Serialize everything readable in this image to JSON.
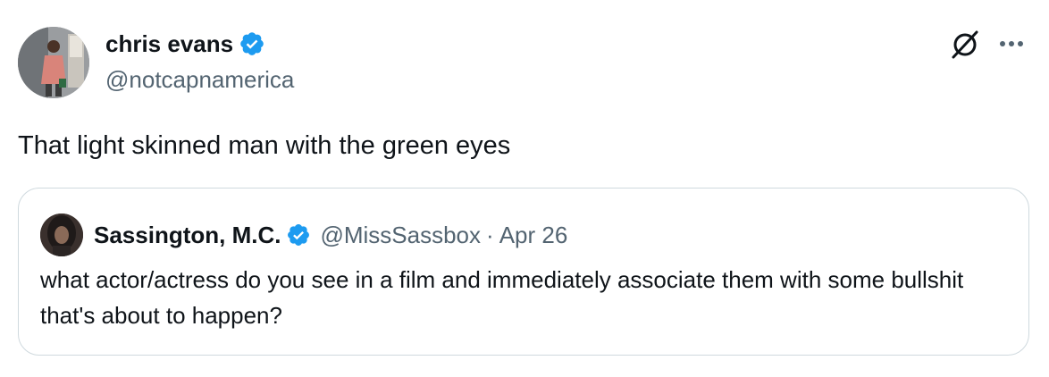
{
  "author": {
    "display_name": "chris evans",
    "handle": "@notcapnamerica",
    "verified": true
  },
  "tweet": {
    "text": "That light skinned man with the green eyes"
  },
  "quoted": {
    "display_name": "Sassington, M.C.",
    "handle": "@MissSassbox",
    "separator": "·",
    "date": "Apr 26",
    "verified": true,
    "text": "what actor/actress do you see in a film and immediately associate them with some bullshit that's about to happen?"
  },
  "icons": {
    "verified": "verified-badge-icon",
    "grok": "grok-icon",
    "more": "more-options-icon"
  },
  "colors": {
    "verified_blue": "#1d9bf0",
    "text_primary": "#0f1419",
    "text_secondary": "#536471",
    "border": "#cfd9de"
  }
}
